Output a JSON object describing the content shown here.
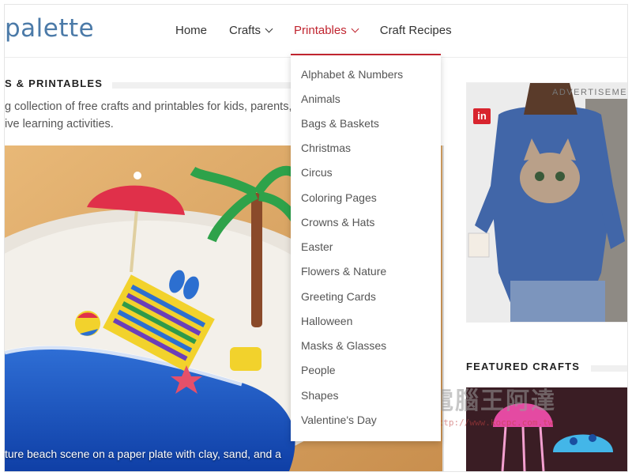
{
  "header": {
    "logo_text": "palette",
    "nav": [
      {
        "label": "Home"
      },
      {
        "label": "Crafts"
      },
      {
        "label": "Printables"
      },
      {
        "label": "Craft Recipes"
      }
    ]
  },
  "dropdown": {
    "items": [
      "Alphabet & Numbers",
      "Animals",
      "Bags & Baskets",
      "Christmas",
      "Circus",
      "Coloring Pages",
      "Crowns & Hats",
      "Easter",
      "Flowers & Nature",
      "Greeting Cards",
      "Halloween",
      "Masks & Glasses",
      "People",
      "Shapes",
      "Valentine's Day"
    ]
  },
  "main": {
    "section_title": "S & PRINTABLES",
    "intro_line1": "g collection of free crafts and printables for kids, parents,",
    "intro_line2": "ive learning activities.",
    "hero_caption": "ture beach scene on a paper plate with clay, sand, and a"
  },
  "sidebar": {
    "ad_label": "ADVERTISEMENT",
    "ad_badge": "in",
    "featured_title": "FEATURED CRAFTS"
  },
  "watermark": {
    "text": "電腦王阿達",
    "url": "http://www.kocpc.com.tw"
  },
  "colors": {
    "accent": "#c0242f",
    "logo": "#4b7aa8"
  }
}
